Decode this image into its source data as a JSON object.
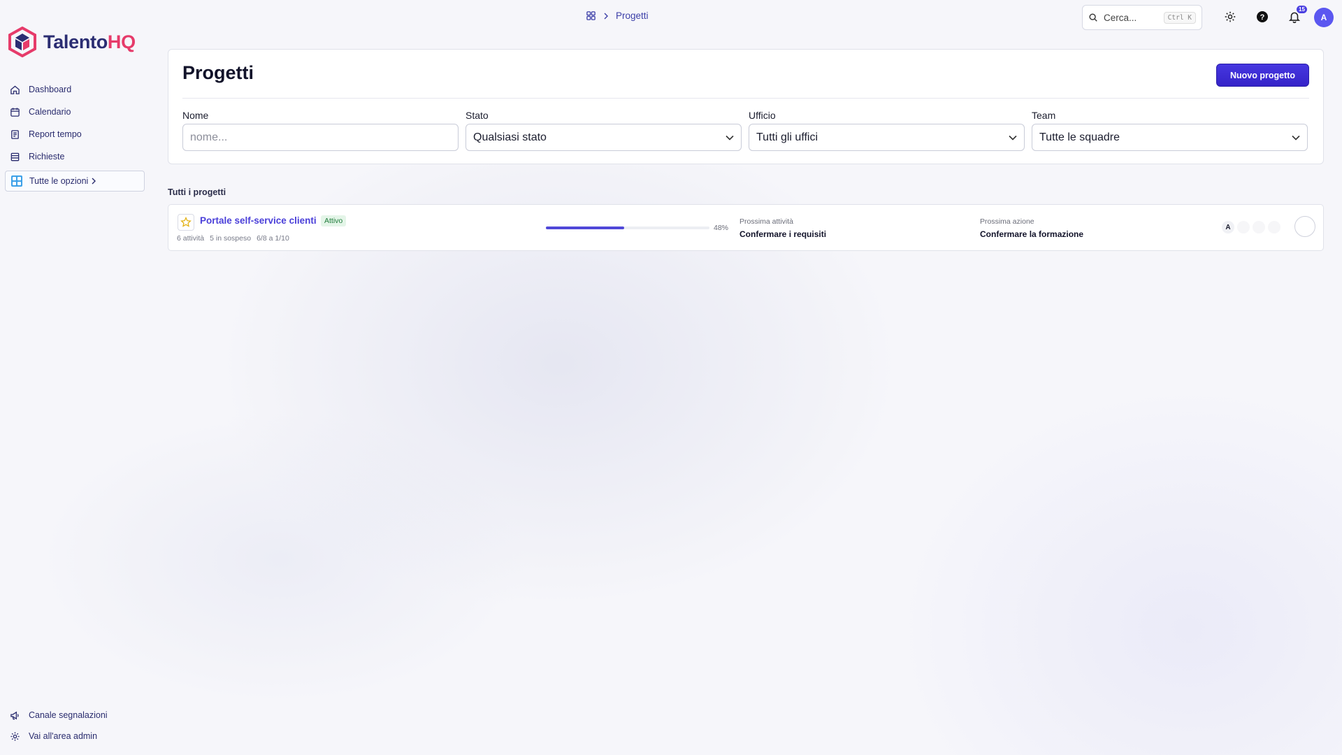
{
  "brand": {
    "part1": "Talento",
    "part2": "HQ"
  },
  "sidebar": {
    "items": [
      {
        "label": "Dashboard",
        "icon": "home-icon"
      },
      {
        "label": "Calendario",
        "icon": "calendar-icon"
      },
      {
        "label": "Report tempo",
        "icon": "report-icon"
      },
      {
        "label": "Richieste",
        "icon": "list-icon"
      }
    ],
    "all_options": "Tutte le opzioni",
    "bottom": [
      {
        "label": "Canale segnalazioni",
        "icon": "megaphone-icon"
      },
      {
        "label": "Vai all'area admin",
        "icon": "gear-icon"
      }
    ]
  },
  "topbar": {
    "breadcrumb": "Progetti",
    "search_placeholder": "Cerca...",
    "search_shortcut": "Ctrl K",
    "notification_count": "15",
    "avatar": "A"
  },
  "header": {
    "title": "Progetti",
    "new_button": "Nuovo progetto"
  },
  "filters": {
    "name": {
      "label": "Nome",
      "placeholder": "nome..."
    },
    "status": {
      "label": "Stato",
      "value": "Qualsiasi stato"
    },
    "office": {
      "label": "Ufficio",
      "value": "Tutti gli uffici"
    },
    "team": {
      "label": "Team",
      "value": "Tutte le squadre"
    }
  },
  "projects": {
    "section_label": "Tutti i progetti",
    "rows": [
      {
        "name": "Portale self-service clienti",
        "status": "Attivo",
        "tasks": "6 attività",
        "pending": "5 in sospeso",
        "dates": "6/8 a 1/10",
        "progress": 0.48,
        "progress_label": "48%",
        "next_activity_label": "Prossima attività",
        "next_activity": "Confermare i requisiti",
        "next_action_label": "Prossima azione",
        "next_action": "Confermare la formazione",
        "member": "A"
      }
    ]
  },
  "colors": {
    "accent": "#4637e0",
    "brand_dark": "#2b2d72",
    "brand_pink": "#e63b6a",
    "active_green": "#1e7b3a"
  }
}
